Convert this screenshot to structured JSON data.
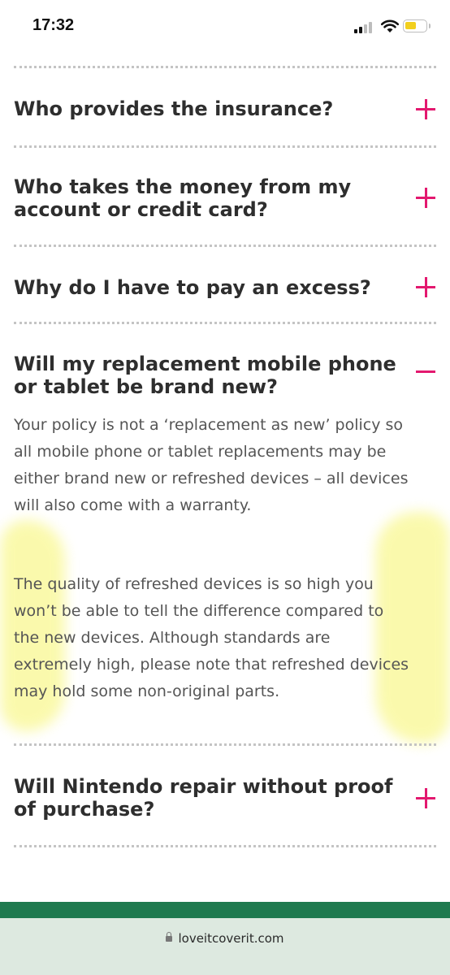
{
  "status_bar": {
    "time": "17:32"
  },
  "faq": [
    {
      "question": "Who provides the insurance?",
      "expanded": false
    },
    {
      "question": "Who takes the money from my account or credit card?",
      "expanded": false
    },
    {
      "question": "Why do I have to pay an excess?",
      "expanded": false
    },
    {
      "question": "Will my replacement mobile phone or tablet be brand new?",
      "expanded": true,
      "answer": [
        "Your policy is not a ‘replacement as new’ policy so all mobile phone or tablet replacements may be either brand new or refreshed devices – all devices will also come with a warranty.",
        "The quality of refreshed devices is so high you won’t be able to tell the difference compared to the new devices. Although standards are extremely high, please note that refreshed devices may hold some non-original parts."
      ]
    },
    {
      "question": "Will Nintendo repair without proof of purchase?",
      "expanded": false
    }
  ],
  "browser": {
    "url": "loveitcoverit.com"
  },
  "colors": {
    "accent": "#e3186f",
    "brand_green": "#1f7a4f",
    "highlight": "#f7f56a"
  }
}
